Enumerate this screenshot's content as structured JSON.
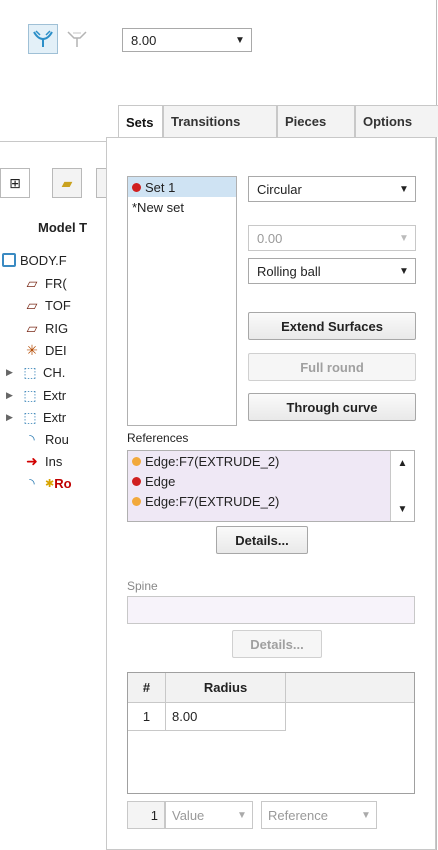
{
  "toolbar": {
    "round_icon": "round-set-icon",
    "chamfer_icon": "round-transition-icon",
    "radius_value": "8.00"
  },
  "tree": {
    "tabs": [
      "model-tree-icon",
      "folder-icon",
      "third-tab"
    ],
    "header": "Model T",
    "items": [
      {
        "label": "BODY.F",
        "icon": "part-icon"
      },
      {
        "label": "FR(",
        "icon": "plane-icon"
      },
      {
        "label": "TOF",
        "icon": "plane-icon"
      },
      {
        "label": "RIG",
        "icon": "plane-icon"
      },
      {
        "label": "DEI",
        "icon": "csys-icon"
      },
      {
        "label": "CH.",
        "icon": "feature-icon",
        "expandable": true
      },
      {
        "label": "Extr",
        "icon": "feature-icon",
        "expandable": true
      },
      {
        "label": "Extr",
        "icon": "feature-icon",
        "expandable": true
      },
      {
        "label": "Rou",
        "icon": "round-icon"
      },
      {
        "label": "Ins",
        "icon": "insert-arrow-icon"
      },
      {
        "label": "Ro",
        "icon": "round-icon",
        "new": true
      }
    ]
  },
  "dashboard": {
    "tabs": [
      "Sets",
      "Transitions",
      "Pieces",
      "Options"
    ],
    "active_tab": "Sets",
    "sets": [
      {
        "label": "Set 1",
        "marker": true
      },
      {
        "label": "*New set",
        "marker": false
      }
    ],
    "shape": "Circular",
    "radius_disabled": "0.00",
    "method": "Rolling ball",
    "extend_surfaces": "Extend Surfaces",
    "full_round": "Full round",
    "through_curve": "Through curve",
    "references_label": "References",
    "references": [
      {
        "label": "Edge:F7(EXTRUDE_2)",
        "color": "#f2a93b"
      },
      {
        "label": "Edge",
        "color": "#d01f1f"
      },
      {
        "label": "Edge:F7(EXTRUDE_2)",
        "color": "#f2a93b"
      }
    ],
    "details_label": "Details...",
    "spine_label": "Spine",
    "spine_details_label": "Details...",
    "table": {
      "headers": [
        "#",
        "Radius"
      ],
      "rows": [
        [
          "1",
          "8.00"
        ]
      ]
    },
    "bottom": {
      "count": "1",
      "value": "Value",
      "reference": "Reference"
    }
  }
}
